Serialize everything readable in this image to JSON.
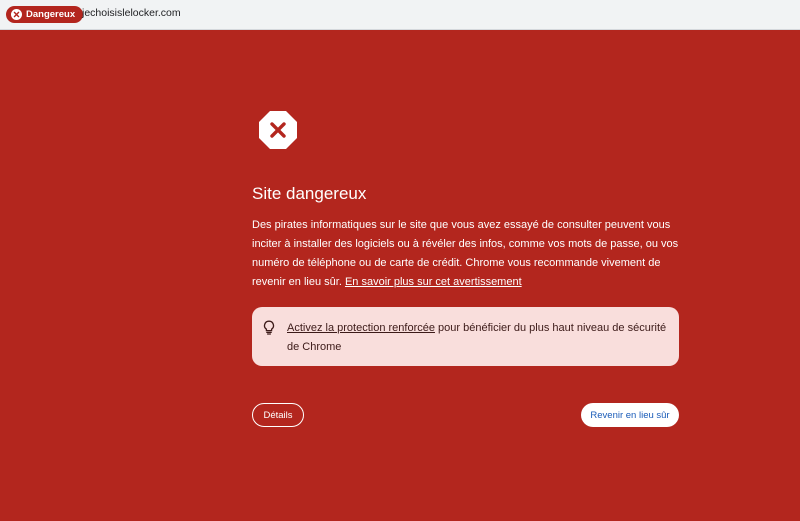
{
  "address_bar": {
    "security_chip_label": "Dangereux",
    "url": "jechoisislelocker.com"
  },
  "warning": {
    "icon": "stop-x-icon",
    "title": "Site dangereux",
    "description": "Des pirates informatiques sur le site que vous avez essayé de consulter peuvent vous inciter à installer des logiciels ou à révéler des infos, comme vos mots de passe, ou vos numéro de téléphone ou de carte de crédit. Chrome vous recommande vivement de revenir en lieu sûr.",
    "learn_more_link": "En savoir plus sur cet avertissement"
  },
  "callout": {
    "icon": "lightbulb-icon",
    "link": "Activez la protection renforcée",
    "text": " pour bénéficier du plus haut niveau de sécurité de Chrome"
  },
  "buttons": {
    "details": "Détails",
    "back_to_safety": "Revenir en lieu sûr"
  },
  "colors": {
    "background": "#b3261e",
    "callout_bg": "#f9dedc",
    "back_button_text": "#1a5bb8"
  }
}
